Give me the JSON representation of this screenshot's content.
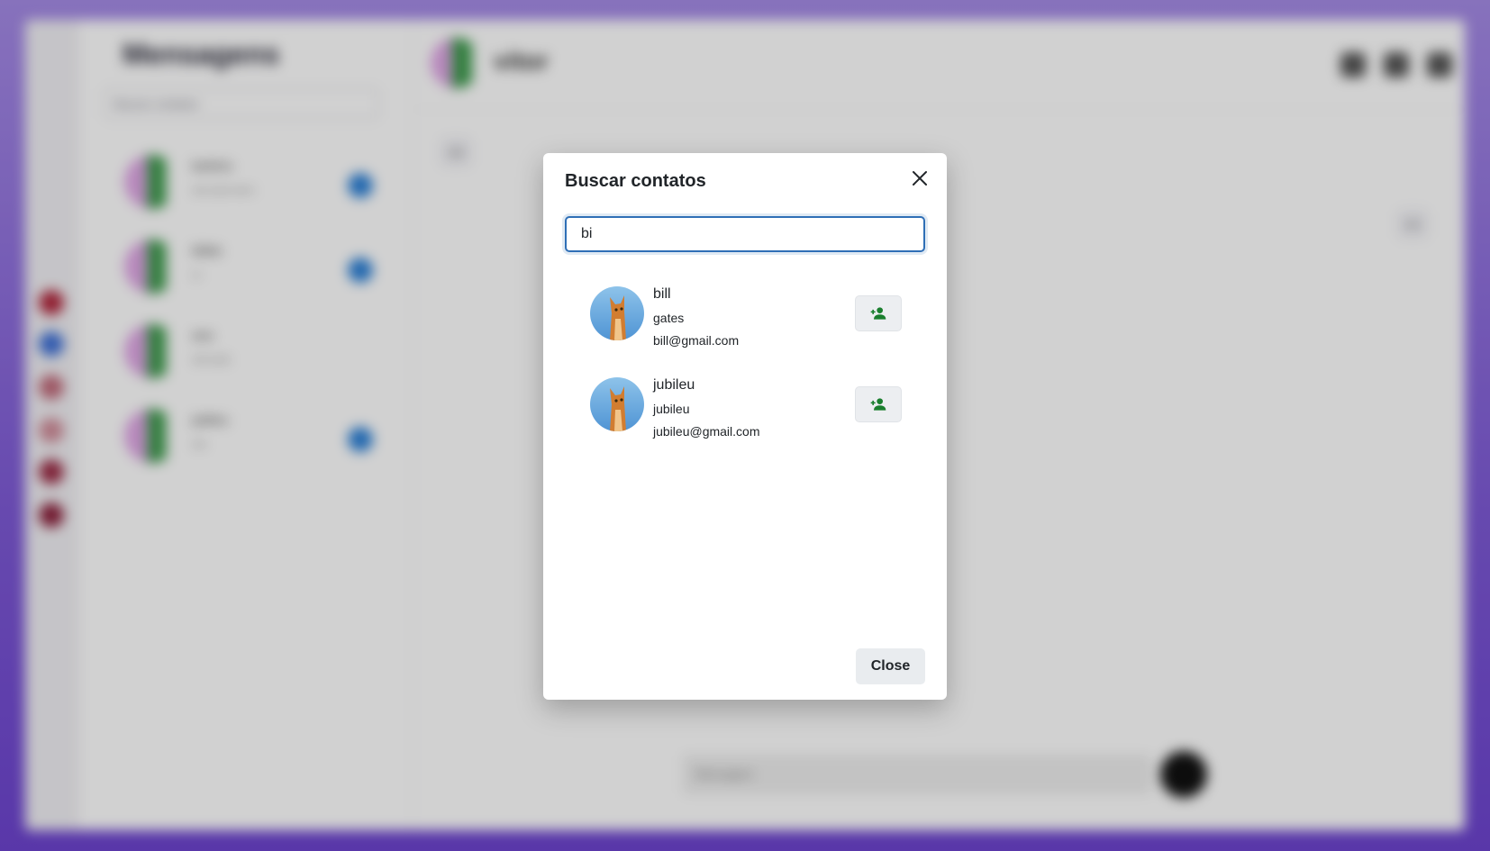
{
  "background": {
    "app_title": "Mensagens",
    "search_placeholder": "Buscar contatos",
    "chats": [
      {
        "name": "bolinho",
        "message": "ola tudo bem"
      },
      {
        "name": "bibite",
        "message": "oi"
      },
      {
        "name": "ana",
        "message": "olá tudo"
      },
      {
        "name": "jubileu",
        "message": "oie"
      }
    ],
    "active_chat_name": "vitor",
    "message_input_placeholder": "Mensagem",
    "bubbles": [
      "olá",
      "oie"
    ]
  },
  "modal": {
    "title": "Buscar contatos",
    "search_value": "bi",
    "close_icon": "close-icon",
    "results": [
      {
        "name": "bill",
        "surname": "gates",
        "email": "bill@gmail.com",
        "action_icon": "add-user-icon"
      },
      {
        "name": "jubileu",
        "surname": "jubileu",
        "email": "jubileu@gmail.com",
        "action_icon": "add-user-icon"
      }
    ],
    "close_label": "Close"
  },
  "colors": {
    "accent": "#2f6fb6",
    "add_icon": "#1a7f2e",
    "page_gradient_top": "#a58be6",
    "page_gradient_bottom": "#6d44cf"
  }
}
